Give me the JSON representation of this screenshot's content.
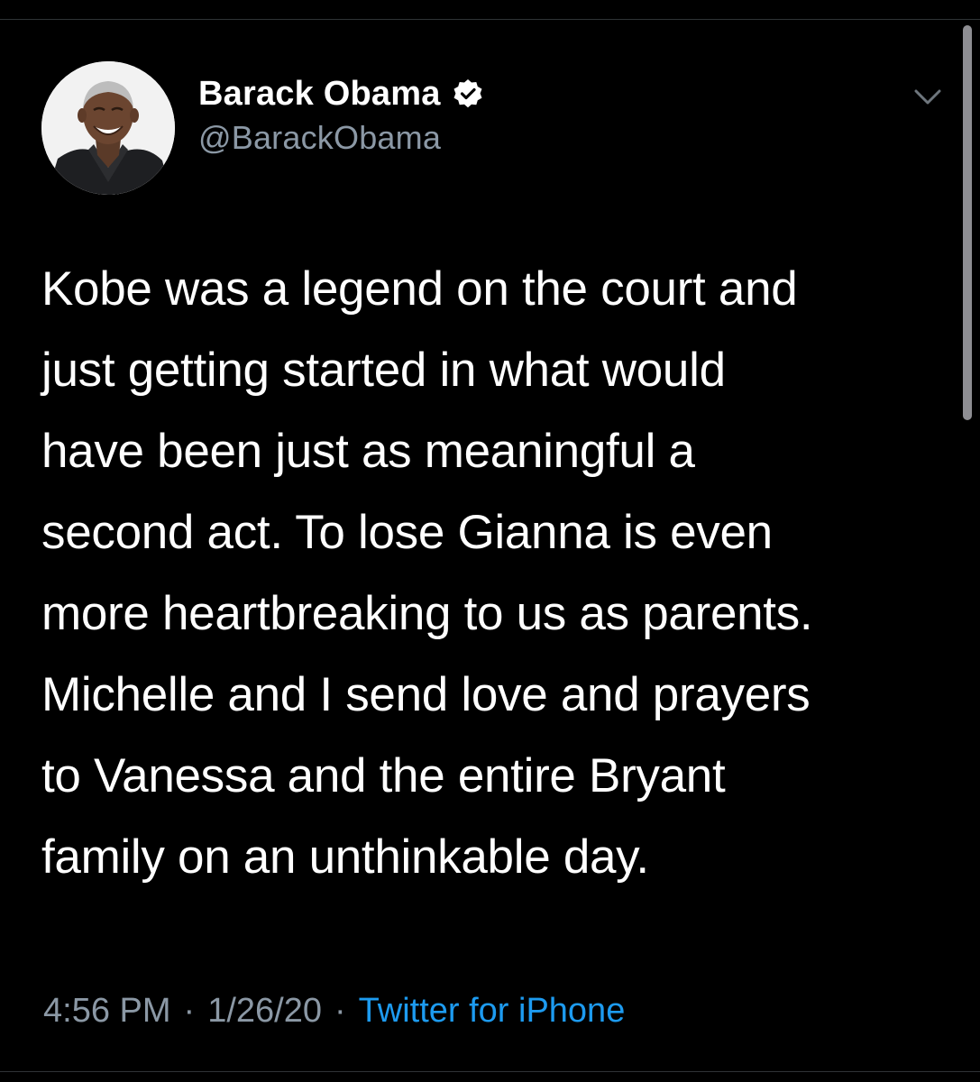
{
  "tweet": {
    "author": {
      "display_name": "Barack Obama",
      "handle": "@BarackObama",
      "verified": true,
      "avatar_icon": "profile-photo",
      "verified_icon": "verified-badge-icon"
    },
    "menu_icon": "chevron-down-icon",
    "text": "Kobe was a legend on the court and\njust getting started in what would\nhave been just as meaningful a\nsecond act. To lose Gianna is even\nmore heartbreaking to us as parents.\nMichelle and I send love and prayers\nto Vanessa and the entire Bryant\nfamily on an unthinkable day.",
    "time": "4:56 PM",
    "separator": "·",
    "date": "1/26/20",
    "source": "Twitter for iPhone"
  },
  "colors": {
    "background": "#000000",
    "text_primary": "#ffffff",
    "text_secondary": "#8b98a5",
    "link_accent": "#1d9bf0",
    "divider": "#2f3336"
  }
}
